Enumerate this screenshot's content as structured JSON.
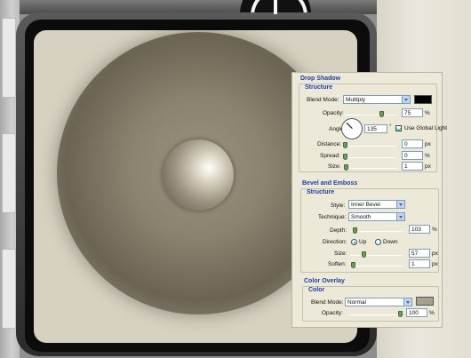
{
  "drop_shadow": {
    "title": "Drop Shadow",
    "structure": "Structure",
    "blend_mode_label": "Blend Mode:",
    "blend_mode_value": "Multiply",
    "shadow_color": "#000000",
    "opacity_label": "Opacity:",
    "opacity_value": "75",
    "opacity_unit": "%",
    "opacity_level": 0.75,
    "angle_label": "Angle:",
    "angle_value": "135",
    "angle_unit": "°",
    "global_light_label": "Use Global Light",
    "global_light_checked": true,
    "distance_label": "Distance:",
    "distance_value": "0",
    "distance_unit": "px",
    "spread_label": "Spread:",
    "spread_value": "0",
    "spread_unit": "%",
    "size_label": "Size:",
    "size_value": "1",
    "size_unit": "px"
  },
  "bevel_emboss": {
    "title": "Bevel and Emboss",
    "structure": "Structure",
    "style_label": "Style:",
    "style_value": "Inner Bevel",
    "technique_label": "Technique:",
    "technique_value": "Smooth",
    "depth_label": "Depth:",
    "depth_value": "103",
    "depth_unit": "%",
    "direction_label": "Direction:",
    "direction_up": "Up",
    "direction_down": "Down",
    "direction_selected": "Up",
    "size_label": "Size:",
    "size_value": "57",
    "size_unit": "px",
    "soften_label": "Soften:",
    "soften_value": "1",
    "soften_unit": "px"
  },
  "color_overlay": {
    "title": "Color Overlay",
    "color_heading": "Color",
    "blend_mode_label": "Blend Mode:",
    "blend_mode_value": "Normal",
    "overlay_color": "#a8a08f",
    "opacity_label": "Opacity:",
    "opacity_value": "100",
    "opacity_unit": "%",
    "opacity_level": 1.0
  },
  "colors": {
    "section_title": "#1f3fa5",
    "panel_bg": "#ece9d8",
    "disc_tone": "#8a826f"
  }
}
